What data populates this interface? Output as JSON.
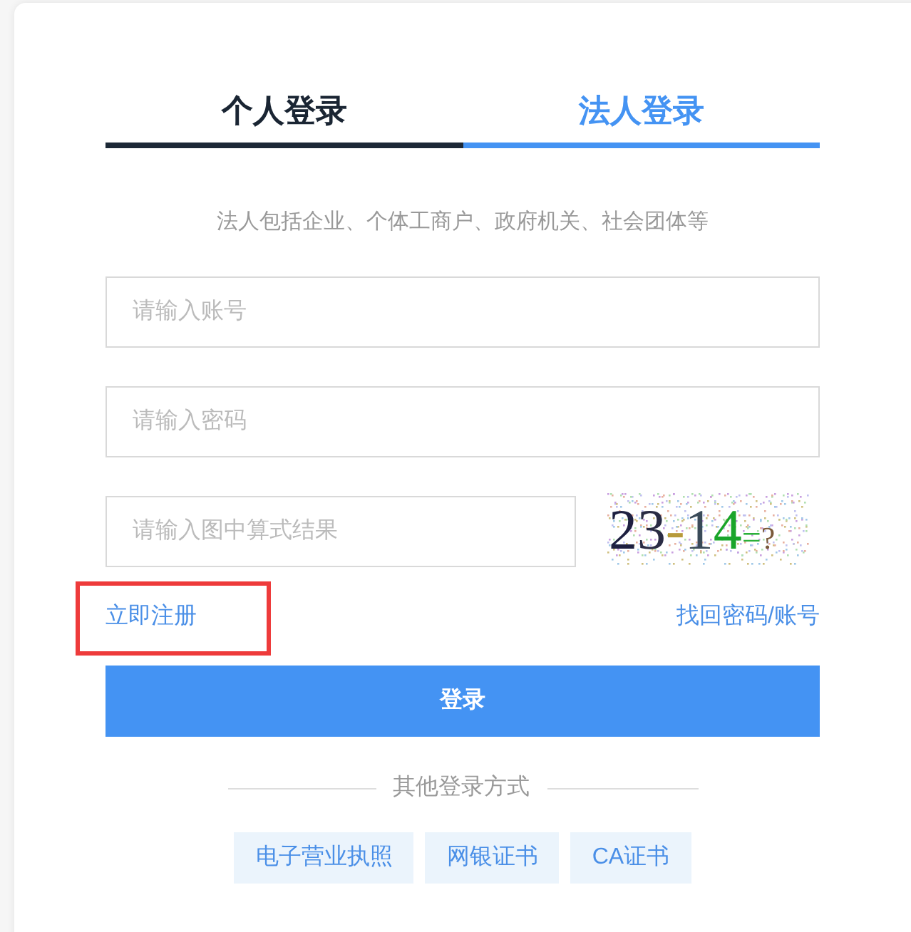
{
  "tabs": [
    {
      "label": "个人登录",
      "selected": false
    },
    {
      "label": "法人登录",
      "selected": true
    }
  ],
  "description": "法人包括企业、个体工商户、政府机关、社会团体等",
  "fields": [
    {
      "placeholder": "请输入账号"
    },
    {
      "placeholder": "请输入密码"
    }
  ],
  "captcha": {
    "placeholder": "请输入图中算式结果",
    "image_text": "23-14=?"
  },
  "links": {
    "register": {
      "label": "立即注册",
      "highlighted": true
    },
    "recover": {
      "label": "找回密码/账号"
    }
  },
  "login_button": "登录",
  "other_methods": {
    "title": "其他登录方式",
    "options": [
      "电子营业执照",
      "网银证书",
      "CA证书"
    ]
  }
}
